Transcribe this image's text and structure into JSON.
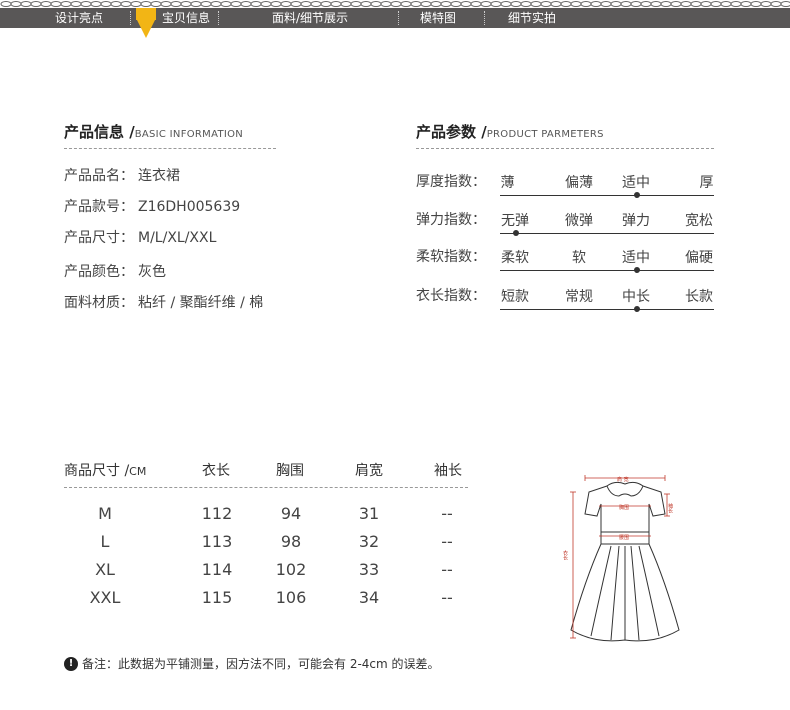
{
  "nav": {
    "items": [
      "设计亮点",
      "宝贝信息",
      "面料/细节展示",
      "模特图",
      "细节实拍"
    ],
    "active_index": 1
  },
  "product_info": {
    "title": "产品信息 /",
    "subtitle": "BASIC INFORMATION",
    "rows": [
      {
        "label": "产品品名：",
        "value": "连衣裙"
      },
      {
        "label": "产品款号：",
        "value": "Z16DH005639"
      },
      {
        "label": "产品尺寸：",
        "value": "M/L/XL/XXL"
      },
      {
        "label": "产品颜色：",
        "value": "灰色"
      },
      {
        "label": "面料材质：",
        "value": "粘纤 / 聚酯纤维 / 棉"
      }
    ]
  },
  "product_params": {
    "title": "产品参数 /",
    "subtitle": "PRODUCT PARMETERS",
    "rows": [
      {
        "label": "厚度指数：",
        "options": [
          "薄",
          "偏薄",
          "适中",
          "厚"
        ],
        "selected_index": 2
      },
      {
        "label": "弹力指数：",
        "options": [
          "无弹",
          "微弹",
          "弹力",
          "宽松"
        ],
        "selected_index": 0
      },
      {
        "label": "柔软指数：",
        "options": [
          "柔软",
          "软",
          "适中",
          "偏硬"
        ],
        "selected_index": 2
      },
      {
        "label": "衣长指数：",
        "options": [
          "短款",
          "常规",
          "中长",
          "长款"
        ],
        "selected_index": 2
      }
    ]
  },
  "size_table": {
    "header_label": "商品尺寸 /",
    "header_unit": "CM",
    "columns": [
      "衣长",
      "胸围",
      "肩宽",
      "袖长"
    ],
    "rows": [
      {
        "size": "M",
        "values": [
          "112",
          "94",
          "31",
          "--"
        ]
      },
      {
        "size": "L",
        "values": [
          "113",
          "98",
          "32",
          "--"
        ]
      },
      {
        "size": "XL",
        "values": [
          "114",
          "102",
          "33",
          "--"
        ]
      },
      {
        "size": "XXL",
        "values": [
          "115",
          "106",
          "34",
          "--"
        ]
      }
    ]
  },
  "diagram": {
    "labels": {
      "shoulder": "肩 宽",
      "chest": "胸围",
      "waist": "腰围",
      "sleeve": "袖长",
      "length": "衣长"
    }
  },
  "note": {
    "icon": "exclamation-icon",
    "text": "备注：此数据为平铺测量，因方法不同，可能会有 2-4cm 的误差。"
  },
  "colors": {
    "nav_bg": "#595757",
    "nav_active": "#f2b515",
    "measure_line": "#c0392b"
  }
}
